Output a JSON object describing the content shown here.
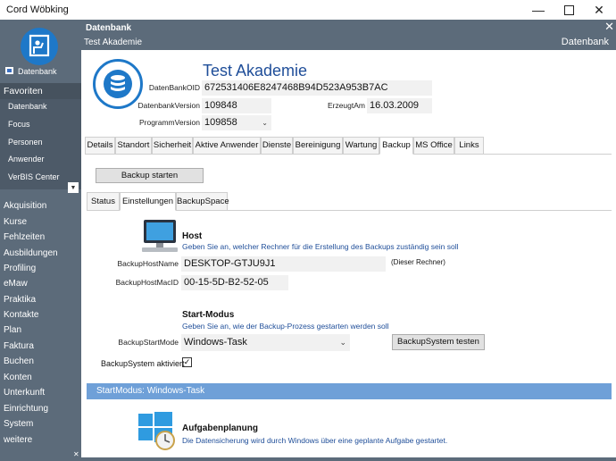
{
  "window": {
    "title": "Cord Wöbking"
  },
  "sidebar": {
    "db_label": "Datenbank",
    "favorites_header": "Favoriten",
    "favorites": [
      "Datenbank",
      "Focus",
      "Personen",
      "Anwender",
      "VerBIS Center"
    ],
    "nav": [
      "Akquisition",
      "Kurse",
      "Fehlzeiten",
      "Ausbildungen",
      "Profiling",
      "eMaw",
      "Praktika",
      "Kontakte",
      "Plan",
      "Faktura",
      "Buchen",
      "Konten",
      "Unterkunft",
      "Einrichtung",
      "System",
      "weitere"
    ]
  },
  "header": {
    "title": "Datenbank",
    "subtitle": "Test Akademie",
    "right": "Datenbank"
  },
  "record": {
    "name": "Test Akademie",
    "oid_label": "DatenBankOID",
    "oid": "672531406E8247468B94D523A953B7AC",
    "version_label": "DatenbankVersion",
    "version": "109848",
    "created_label": "ErzeugtAm",
    "created": "16.03.2009",
    "prog_label": "ProgrammVersion",
    "prog": "109858"
  },
  "tabs": [
    "Details",
    "Standort",
    "Sicherheit",
    "Aktive Anwender",
    "Dienste",
    "Bereinigung",
    "Wartung",
    "Backup",
    "MS Office",
    "Links"
  ],
  "active_tab": "Backup",
  "backup": {
    "start_button": "Backup starten",
    "subtabs": [
      "Status",
      "Einstellungen",
      "BackupSpace"
    ],
    "active_subtab": "Einstellungen",
    "host_title": "Host",
    "host_hint": "Geben Sie an, welcher Rechner für die Erstellung des Backups zuständig sein soll",
    "host_name_label": "BackupHostName",
    "host_name": "DESKTOP-GTJU9J1",
    "host_note": "(Dieser Rechner)",
    "host_mac_label": "BackupHostMacID",
    "host_mac": "00-15-5D-B2-52-05",
    "mode_title": "Start-Modus",
    "mode_hint": "Geben Sie an, wie der Backup-Prozess gestarten werden soll",
    "mode_label": "BackupStartMode",
    "mode_value": "Windows-Task",
    "test_button": "BackupSystem testen",
    "active_label": "BackupSystem aktiviert",
    "active_checked": true,
    "band_text": "StartModus: Windows-Task",
    "task_title": "Aufgabenplanung",
    "task_hint": "Die Datensicherung wird durch Windows über eine geplante Aufgabe gestartet."
  },
  "colors": {
    "sidebar": "#5c6b7a",
    "accent": "#1e78c8",
    "band": "#6fa0d8"
  }
}
